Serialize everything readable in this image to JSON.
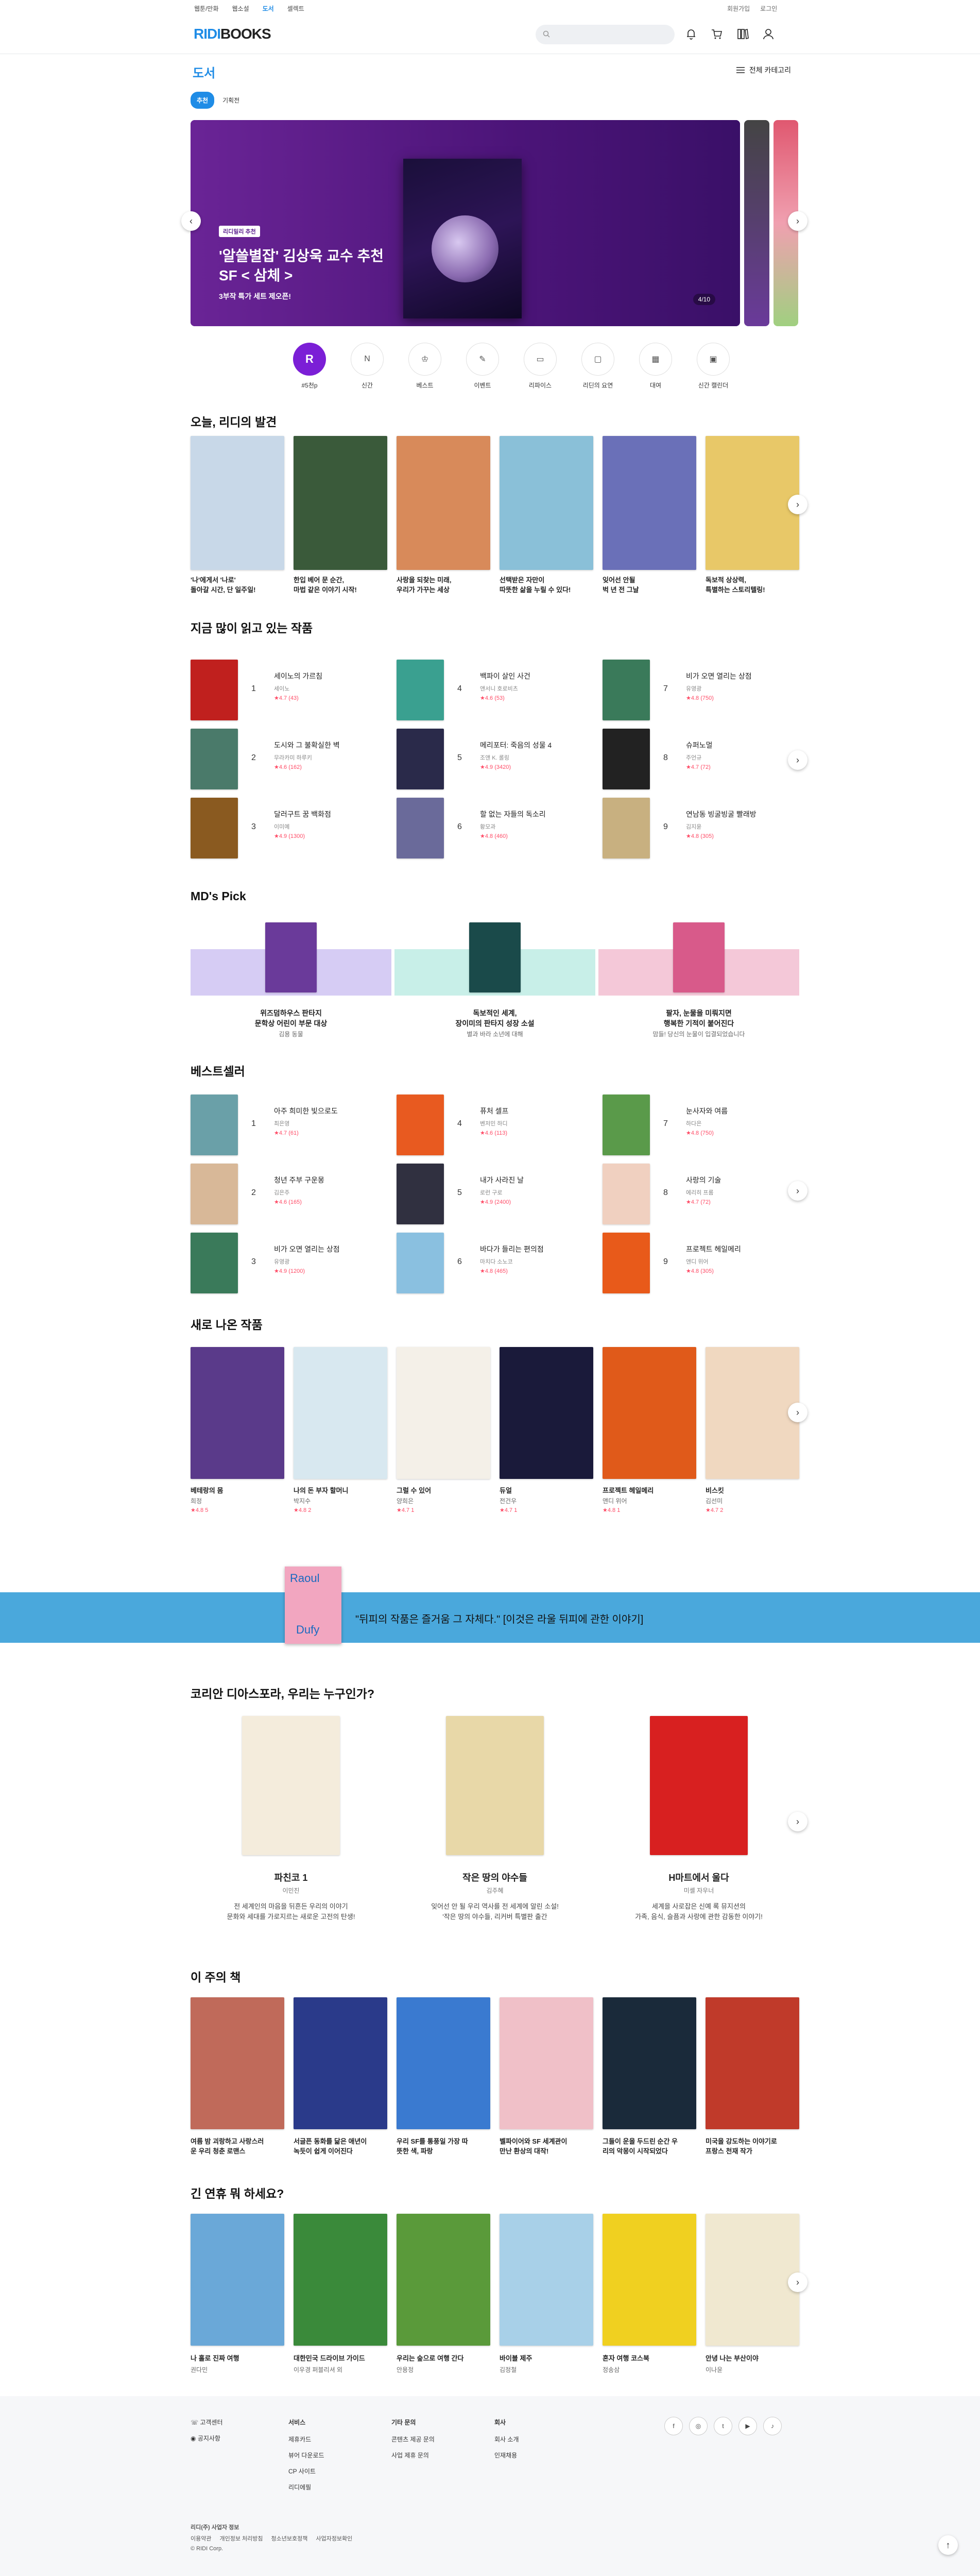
{
  "topbar": {
    "left": [
      "웹툰/만화",
      "웹소설",
      "도서",
      "셀렉트"
    ],
    "right": [
      "회원가입",
      "로그인"
    ]
  },
  "header": {
    "logo_ridi": "RIDI",
    "logo_books": "BOOKS"
  },
  "subnav": {
    "title": "도서",
    "category_label": "전체 카테고리"
  },
  "pills": {
    "active": "추천",
    "other": "기획전"
  },
  "hero": {
    "badge": "리디밀리 추천",
    "title": "'알쓸별잡' 김상욱 교수 추천 SF < 삼체 >",
    "subtitle": "3부작 특가 세트 제오픈!",
    "counter": "4/10"
  },
  "quick": [
    {
      "icon": "R",
      "label": "#5천p"
    },
    {
      "icon": "N",
      "label": "신간"
    },
    {
      "icon": "♔",
      "label": "베스트"
    },
    {
      "icon": "✎",
      "label": "이벤트"
    },
    {
      "icon": "▭",
      "label": "리파이스"
    },
    {
      "icon": "▢",
      "label": "리딘의 요연"
    },
    {
      "icon": "▦",
      "label": "대여"
    },
    {
      "icon": "▣",
      "label": "신간 캘린더"
    }
  ],
  "discover": {
    "title": "오늘, 리디의 발견",
    "items": [
      {
        "line1": "'나'에게서 '나로'",
        "line2": "돌아갈 시간, 단 일주일!",
        "color": "#c8d8e8"
      },
      {
        "line1": "한입 베어 문 순간,",
        "line2": "마법 같은 이야기 시작!",
        "color": "#3a5a3a"
      },
      {
        "line1": "사랑을 되찾는 미래,",
        "line2": "우리가 가꾸는 세상",
        "color": "#d88a5a"
      },
      {
        "line1": "선택받은 자만이",
        "line2": "따뜻한 삶을 누릴 수 있다!",
        "color": "#8ac0d8"
      },
      {
        "line1": "잊어선 안될",
        "line2": "벅 년 전 그날",
        "color": "#6a70b8"
      },
      {
        "line1": "독보적 상상력,",
        "line2": "특별하는 스토리텔링!",
        "color": "#e8c868"
      }
    ]
  },
  "reading": {
    "title": "지금 많이 읽고 있는 작품",
    "items": [
      {
        "rank": "1",
        "title": "세이노의 가르침",
        "author": "세이노",
        "rating": "★4.7 (43)",
        "color": "#c0201e"
      },
      {
        "rank": "2",
        "title": "도시와 그 불확실한 벽",
        "author": "무라카미 하루키",
        "rating": "★4.6 (162)",
        "color": "#4a7a6a"
      },
      {
        "rank": "3",
        "title": "달러구트 꿈 백화점",
        "author": "이미예",
        "rating": "★4.9 (1300)",
        "color": "#8a5a20"
      },
      {
        "rank": "4",
        "title": "백파이 살인 사건",
        "author": "앤서니 호로비츠",
        "rating": "★4.6 (53)",
        "color": "#3aa090"
      },
      {
        "rank": "5",
        "title": "메리포터: 죽음의 성물 4",
        "author": "조앤 K. 롤링",
        "rating": "★4.9 (3420)",
        "color": "#2a2a4a"
      },
      {
        "rank": "6",
        "title": "할 없는 자들의 독소리",
        "author": "황모과",
        "rating": "★4.8 (460)",
        "color": "#6a6a9a"
      },
      {
        "rank": "7",
        "title": "비가 오면 열리는 상점",
        "author": "유영광",
        "rating": "★4.8 (750)",
        "color": "#3a7a5a"
      },
      {
        "rank": "8",
        "title": "슈퍼노멀",
        "author": "주언규",
        "rating": "★4.7 (72)",
        "color": "#222"
      },
      {
        "rank": "9",
        "title": "연남동 빙굴빙굴 빨래방",
        "author": "김지윤",
        "rating": "★4.8 (305)",
        "color": "#c8b080"
      }
    ]
  },
  "mdpick": {
    "title": "MD's Pick",
    "items": [
      {
        "l1": "위즈덤하우스 판타지",
        "l2": "문학상 어린이 부문 대상",
        "l3": "김용 동물",
        "band": "#d6ccf4",
        "color": "#6a3a9a"
      },
      {
        "l1": "독보적인 세계,",
        "l2": "장이미의 판타지 성장 소설",
        "l3": "별과 바라 소년에 대해",
        "band": "#c8efe8",
        "color": "#1a4a4a"
      },
      {
        "l1": "팔자, 눈물을 미뤄지면",
        "l2": "행복한 기적이 붙어진다",
        "l3": "맘들! 당신의 눈물이 입결되었습니다",
        "band": "#f4c8d8",
        "color": "#d85a8a"
      }
    ]
  },
  "best": {
    "title": "베스트셀러",
    "items": [
      {
        "rank": "1",
        "title": "아주 희미한 빛으로도",
        "author": "최은영",
        "rating": "★4.7 (61)",
        "color": "#6aa0a8"
      },
      {
        "rank": "2",
        "title": "청년 주부 구운몽",
        "author": "김은주",
        "rating": "★4.6 (165)",
        "color": "#d8b898"
      },
      {
        "rank": "3",
        "title": "비가 오면 열리는 상점",
        "author": "유영광",
        "rating": "★4.9 (1200)",
        "color": "#3a7a5a"
      },
      {
        "rank": "4",
        "title": "퓨처 셀프",
        "author": "벤저민 하디",
        "rating": "★4.6 (113)",
        "color": "#e85a20"
      },
      {
        "rank": "5",
        "title": "내가 사라진 날",
        "author": "로런 구로",
        "rating": "★4.9 (2400)",
        "color": "#303040"
      },
      {
        "rank": "6",
        "title": "바다가 들리는 편의점",
        "author": "마치다 소노코",
        "rating": "★4.8 (465)",
        "color": "#8ac0e0"
      },
      {
        "rank": "7",
        "title": "눈사자와 여름",
        "author": "하다은",
        "rating": "★4.8 (750)",
        "color": "#5a9a4a"
      },
      {
        "rank": "8",
        "title": "사랑의 기술",
        "author": "에리히 프롬",
        "rating": "★4.7 (72)",
        "color": "#f0d0c0"
      },
      {
        "rank": "9",
        "title": "프로젝트 헤일메리",
        "author": "앤디 위어",
        "rating": "★4.8 (305)",
        "color": "#e85a1a"
      }
    ]
  },
  "newbooks": {
    "title": "새로 나온 작품",
    "items": [
      {
        "title": "베테랑의 몸",
        "author": "희정",
        "rating": "★4.8 5",
        "color": "#5a3a8a"
      },
      {
        "title": "나의 돈 부자 할머니",
        "author": "박지수",
        "rating": "★4.8 2",
        "color": "#d8e8f0"
      },
      {
        "title": "그럴 수 있어",
        "author": "양희은",
        "rating": "★4.7 1",
        "color": "#f4f0e8"
      },
      {
        "title": "듀얼",
        "author": "전건우",
        "rating": "★4.7 1",
        "color": "#1a1a3a"
      },
      {
        "title": "프로젝트 헤일메리",
        "author": "앤디 위어",
        "rating": "★4.8 1",
        "color": "#e05a1a"
      },
      {
        "title": "비스킷",
        "author": "김선미",
        "rating": "★4.7 2",
        "color": "#f0d8c0"
      }
    ]
  },
  "banner": {
    "text": "\"뒤피의 작품은 즐거움 그 자체다.\" [이것은 라울 뒤피에 관한 이야기]",
    "cover_line1": "Raoul",
    "cover_line2": "Dufy"
  },
  "korean": {
    "title": "코리안 디아스포라, 우리는 누구인가?",
    "items": [
      {
        "title": "파친코 1",
        "author": "이민진",
        "d1": "전 세계인의 마음을 뒤흔든 우리의 이야기",
        "d2": "문화와 세대를 가로지르는 새로운 고전의 탄생!",
        "color": "#f4ecdc"
      },
      {
        "title": "작은 땅의 야수들",
        "author": "김주혜",
        "d1": "잊어선 안 될 우리 역사를 전 세계에 알린 소설!",
        "d2": "'작은 땅의 야수들, 리커버 특별판 출간",
        "color": "#e8d8a8"
      },
      {
        "title": "H마트에서 울다",
        "author": "미셸 자우너",
        "d1": "세계을 사로잡은 신예 록 뮤지션의",
        "d2": "가족, 음식, 슬픔과 사랑에 관한 감동한 이야기!",
        "color": "#d82020"
      }
    ]
  },
  "featured": {
    "title": "이 주의 책",
    "items": [
      {
        "line1": "여름 밤 괴랑하고 사랑스러",
        "line2": "운 우리 청춘 로맨스",
        "color": "#c06a5a"
      },
      {
        "line1": "서글픈 동화를 닮은 애년이",
        "line2": "녹듯이 쉽게 이어진다",
        "color": "#2a3a8a"
      },
      {
        "line1": "우리 SF를 통풍일 가장 따",
        "line2": "뜻한 색, 파랑",
        "color": "#3a7ad0"
      },
      {
        "line1": "벨파이어와 SF 세계관이",
        "line2": "만난 환상의 대작!",
        "color": "#f0c0c8"
      },
      {
        "line1": "그들이 운을 두드린 순간 우",
        "line2": "리의 악몽이 시작되었다",
        "color": "#1a2a3a"
      },
      {
        "line1": "미국을 강도하는 이야기로",
        "line2": "프랑스 천재 작가",
        "color": "#c03a2a"
      }
    ]
  },
  "vacation": {
    "title": "긴 연휴 뭐 하세요?",
    "items": [
      {
        "title": "나 홀로 진짜 여행",
        "author": "권다민",
        "color": "#6aa8d8"
      },
      {
        "title": "대한민국 드라이브 가이드",
        "author": "이우경 퍼블리셔 외",
        "color": "#3a8a3a"
      },
      {
        "title": "우리는 숲으로 여행 간다",
        "author": "안용정",
        "color": "#5a9a3a"
      },
      {
        "title": "바이블 제주",
        "author": "김정철",
        "color": "#a8d0e8"
      },
      {
        "title": "혼자 여행 코스북",
        "author": "정송삼",
        "color": "#f0d020"
      },
      {
        "title": "안녕 나는 부산이야",
        "author": "이나윤",
        "color": "#f0e8d0"
      }
    ]
  },
  "footer": {
    "support": [
      "고객센터",
      "공지사항"
    ],
    "service_head": "서비스",
    "service": [
      "제휴카드",
      "뷰어 다운로드",
      "CP 사이트",
      "리디에필"
    ],
    "other_head": "기타 문의",
    "other": [
      "콘텐츠 제공 문의",
      "사업 제휴 문의"
    ],
    "company_head": "회사",
    "company": [
      "회사 소개",
      "인재채용"
    ],
    "sns": [
      "f",
      "◎",
      "t",
      "▶",
      "♪"
    ],
    "biz": "리디(주) 사업자 정보",
    "links": [
      "이용약관",
      "개인정보 처리방침",
      "청소년보호정책",
      "사업자정보확인"
    ],
    "copy": "© RIDI Corp."
  }
}
